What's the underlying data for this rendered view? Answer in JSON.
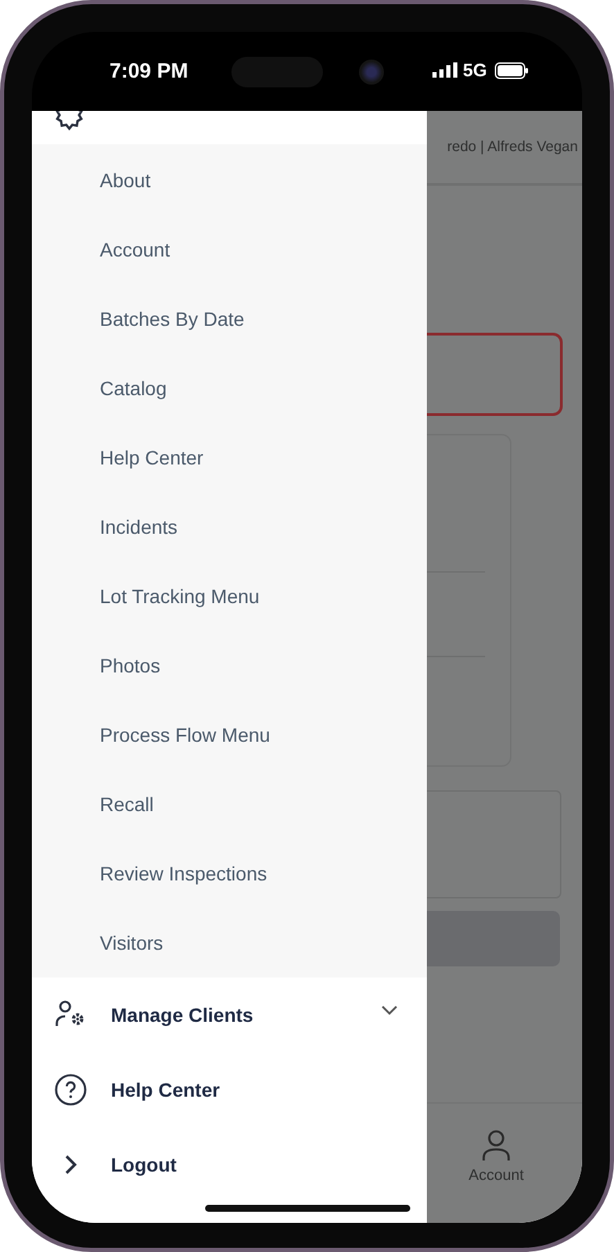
{
  "status_bar": {
    "time": "7:09 PM",
    "network": "5G"
  },
  "drawer": {
    "submenu": [
      {
        "label": "About"
      },
      {
        "label": "Account"
      },
      {
        "label": "Batches By Date"
      },
      {
        "label": "Catalog"
      },
      {
        "label": "Help Center"
      },
      {
        "label": "Incidents"
      },
      {
        "label": "Lot Tracking Menu"
      },
      {
        "label": "Photos"
      },
      {
        "label": "Process Flow Menu"
      },
      {
        "label": "Recall"
      },
      {
        "label": "Review Inspections"
      },
      {
        "label": "Visitors"
      }
    ],
    "items": [
      {
        "kind": "clients",
        "label": "Manage Clients",
        "expanded": false
      },
      {
        "kind": "help",
        "label": "Help Center"
      },
      {
        "kind": "logout",
        "label": "Logout"
      }
    ]
  },
  "background": {
    "header_text": "redo | Alfreds Vegan",
    "bottom_nav": [
      {
        "label": "Account"
      }
    ]
  }
}
